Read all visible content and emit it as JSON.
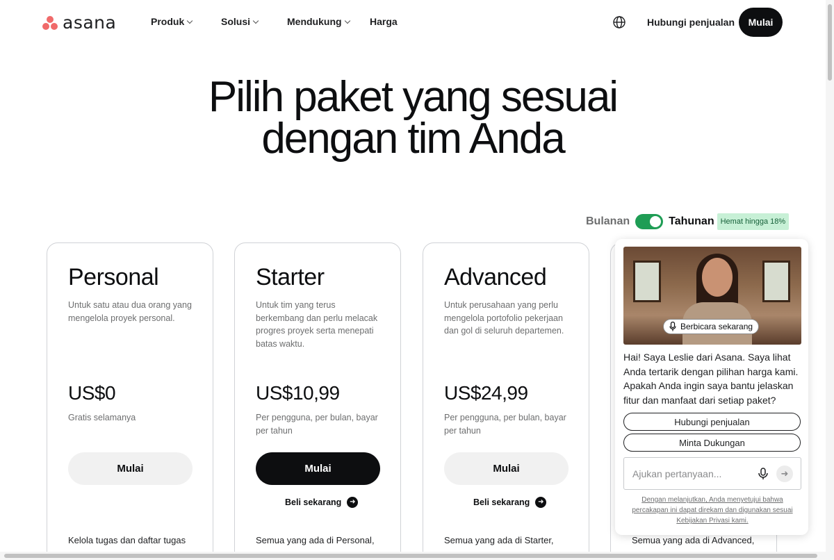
{
  "header": {
    "logo_text": "asana",
    "nav": [
      {
        "label": "Produk",
        "has_dropdown": true
      },
      {
        "label": "Solusi",
        "has_dropdown": true
      },
      {
        "label": "Mendukung",
        "has_dropdown": true
      },
      {
        "label": "Harga",
        "has_dropdown": false
      }
    ],
    "language_icon": "globe-icon",
    "contact_sales": "Hubungi penjualan",
    "start": "Mulai"
  },
  "hero": {
    "line1": "Pilih paket yang sesuai",
    "line2": "dengan tim Anda"
  },
  "billing": {
    "monthly": "Bulanan",
    "yearly": "Tahunan",
    "yearly_selected": true,
    "save_badge": "Hemat hingga 18%"
  },
  "plans": [
    {
      "name": "Personal",
      "description": "Untuk satu atau dua orang yang mengelola proyek personal.",
      "price": "US$0",
      "price_note": "Gratis selamanya",
      "cta": "Mulai",
      "buy_now": "",
      "feature": "Kelola tugas dan daftar tugas"
    },
    {
      "name": "Starter",
      "description": "Untuk tim yang terus berkembang dan perlu melacak progres proyek serta menepati batas waktu.",
      "price": "US$10,99",
      "price_note": "Per pengguna, per bulan, bayar per tahun",
      "cta": "Mulai",
      "buy_now": "Beli sekarang",
      "feature": "Semua yang ada di Personal,"
    },
    {
      "name": "Advanced",
      "description": "Untuk perusahaan yang perlu mengelola portofolio pekerjaan dan gol di seluruh departemen.",
      "price": "US$24,99",
      "price_note": "Per pengguna, per bulan, bayar per tahun",
      "cta": "Mulai",
      "buy_now": "Beli sekarang",
      "feature": "Semua yang ada di Starter,"
    },
    {
      "feature": "Semua yang ada di Advanced,"
    }
  ],
  "chat": {
    "speak_now": "Berbicara sekarang",
    "message": "Hai! Saya Leslie dari Asana. Saya lihat Anda tertarik dengan pilihan harga kami. Apakah Anda ingin saya bantu jelaskan fitur dan manfaat dari setiap paket?",
    "contact_sales": "Hubungi penjualan",
    "get_support": "Minta Dukungan",
    "input_placeholder": "Ajukan pertanyaan...",
    "legal": "Dengan melanjutkan, Anda menyetujui bahwa percakapan ini dapat direkam dan digunakan sesuai Kebijakan Privasi kami."
  },
  "colors": {
    "brand": "#f06a6a",
    "toggle_on": "#1f9d55",
    "dark_button": "#0d0e10"
  }
}
